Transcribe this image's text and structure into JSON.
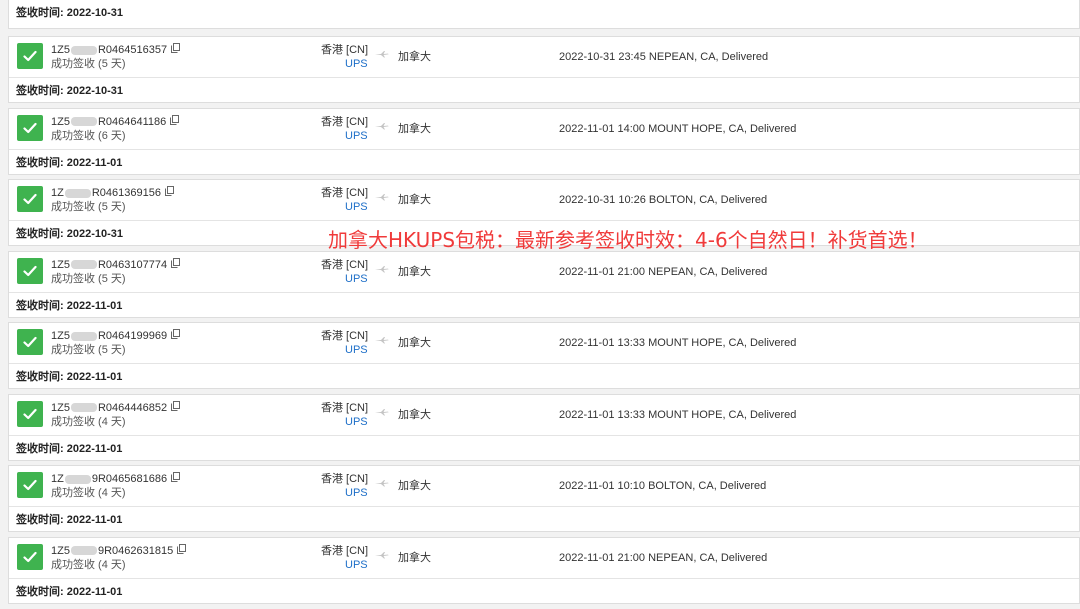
{
  "first_partial": {
    "sign_label": "签收时间:",
    "sign_date": "2022-10-31"
  },
  "overlay_text": "加拿大HKUPS包税：最新参考签收时效：4-6个自然日！补货首选！",
  "shipments": [
    {
      "tracking_prefix": "1Z5",
      "tracking_suffix": "R0464516357",
      "status": "成功签收 (5 天)",
      "origin": "香港 [CN]",
      "carrier": "UPS",
      "destination": "加拿大",
      "last_event": "2022-10-31 23:45 NEPEAN, CA, Delivered",
      "sign_label": "签收时间:",
      "sign_date": "2022-10-31"
    },
    {
      "tracking_prefix": "1Z5",
      "tracking_suffix": "R0464641186",
      "status": "成功签收 (6 天)",
      "origin": "香港 [CN]",
      "carrier": "UPS",
      "destination": "加拿大",
      "last_event": "2022-11-01 14:00 MOUNT HOPE, CA, Delivered",
      "sign_label": "签收时间:",
      "sign_date": "2022-11-01"
    },
    {
      "tracking_prefix": "1Z",
      "tracking_suffix": "R0461369156",
      "status": "成功签收 (5 天)",
      "origin": "香港 [CN]",
      "carrier": "UPS",
      "destination": "加拿大",
      "last_event": "2022-10-31 10:26 BOLTON, CA, Delivered",
      "sign_label": "签收时间:",
      "sign_date": "2022-10-31"
    },
    {
      "tracking_prefix": "1Z5",
      "tracking_suffix": "R0463107774",
      "status": "成功签收 (5 天)",
      "origin": "香港 [CN]",
      "carrier": "UPS",
      "destination": "加拿大",
      "last_event": "2022-11-01 21:00 NEPEAN, CA, Delivered",
      "sign_label": "签收时间:",
      "sign_date": "2022-11-01"
    },
    {
      "tracking_prefix": "1Z5",
      "tracking_suffix": "R0464199969",
      "status": "成功签收 (5 天)",
      "origin": "香港 [CN]",
      "carrier": "UPS",
      "destination": "加拿大",
      "last_event": "2022-11-01 13:33 MOUNT HOPE, CA, Delivered",
      "sign_label": "签收时间:",
      "sign_date": "2022-11-01"
    },
    {
      "tracking_prefix": "1Z5",
      "tracking_suffix": "R0464446852",
      "status": "成功签收 (4 天)",
      "origin": "香港 [CN]",
      "carrier": "UPS",
      "destination": "加拿大",
      "last_event": "2022-11-01 13:33 MOUNT HOPE, CA, Delivered",
      "sign_label": "签收时间:",
      "sign_date": "2022-11-01"
    },
    {
      "tracking_prefix": "1Z",
      "tracking_suffix": "9R0465681686",
      "status": "成功签收 (4 天)",
      "origin": "香港 [CN]",
      "carrier": "UPS",
      "destination": "加拿大",
      "last_event": "2022-11-01 10:10 BOLTON, CA, Delivered",
      "sign_label": "签收时间:",
      "sign_date": "2022-11-01"
    },
    {
      "tracking_prefix": "1Z5",
      "tracking_suffix": "9R0462631815",
      "status": "成功签收 (4 天)",
      "origin": "香港 [CN]",
      "carrier": "UPS",
      "destination": "加拿大",
      "last_event": "2022-11-01 21:00 NEPEAN, CA, Delivered",
      "sign_label": "签收时间:",
      "sign_date": "2022-11-01"
    }
  ],
  "colors": {
    "check_green": "#3fb34f",
    "carrier_blue": "#1e6fc8",
    "overlay_red": "#f03a3a"
  },
  "icons": {
    "status": "checkmark-icon",
    "copy": "copy-icon",
    "route": "plane-icon"
  }
}
